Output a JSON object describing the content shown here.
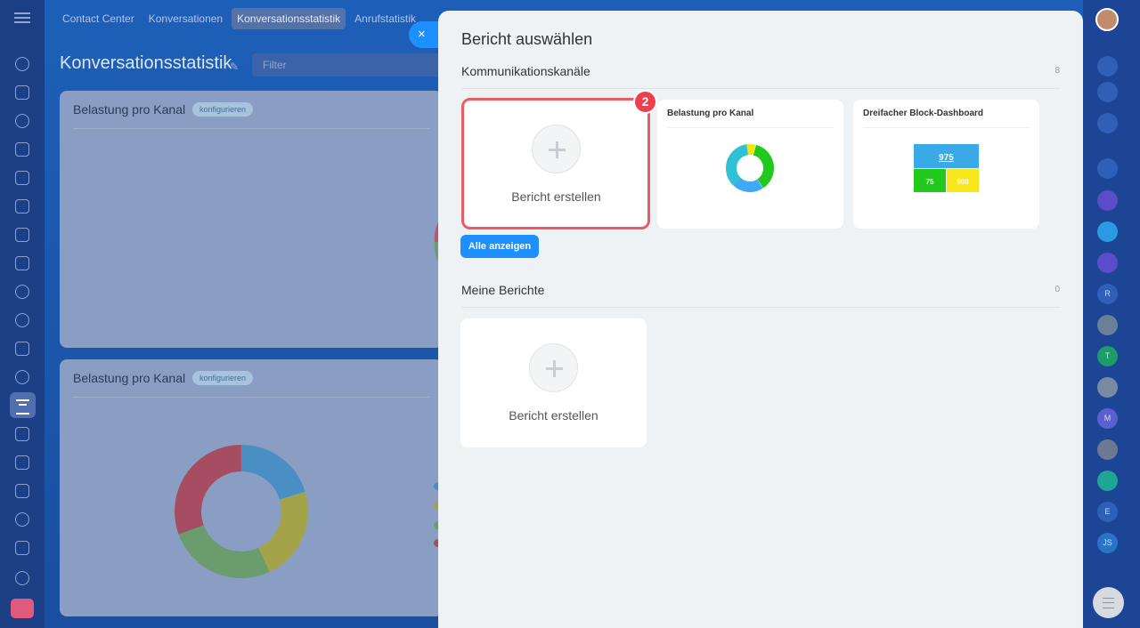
{
  "top_nav": {
    "tabs": [
      {
        "label": "Contact Center"
      },
      {
        "label": "Konversationen"
      },
      {
        "label": "Konversationsstatistik"
      },
      {
        "label": "Anrufstatistik"
      }
    ]
  },
  "page": {
    "title": "Konversationsstatistik",
    "filter_placeholder": "Filter",
    "cards": [
      {
        "title": "Belastung pro Kanal",
        "badge": "konfigurieren"
      },
      {
        "title": "Belastung pro Kanal",
        "badge": "konfigurieren"
      }
    ]
  },
  "panel": {
    "close_label": "×",
    "title": "Bericht auswählen",
    "section1": {
      "label": "Kommunikationskanäle",
      "count": "8",
      "create_label": "Bericht erstellen",
      "step_badge": "2",
      "cards": [
        {
          "title": "Belastung pro Kanal"
        },
        {
          "title": "Dreifacher Block-Dashboard",
          "big_value": "975",
          "small_values": [
            "75",
            "900"
          ]
        }
      ],
      "show_all_label": "Alle anzeigen"
    },
    "section2": {
      "label": "Meine Berichte",
      "count": "0",
      "create_label": "Bericht erstellen"
    }
  },
  "right_bar": {
    "letters": [
      "R",
      "T",
      "M",
      "E",
      "JS"
    ]
  }
}
